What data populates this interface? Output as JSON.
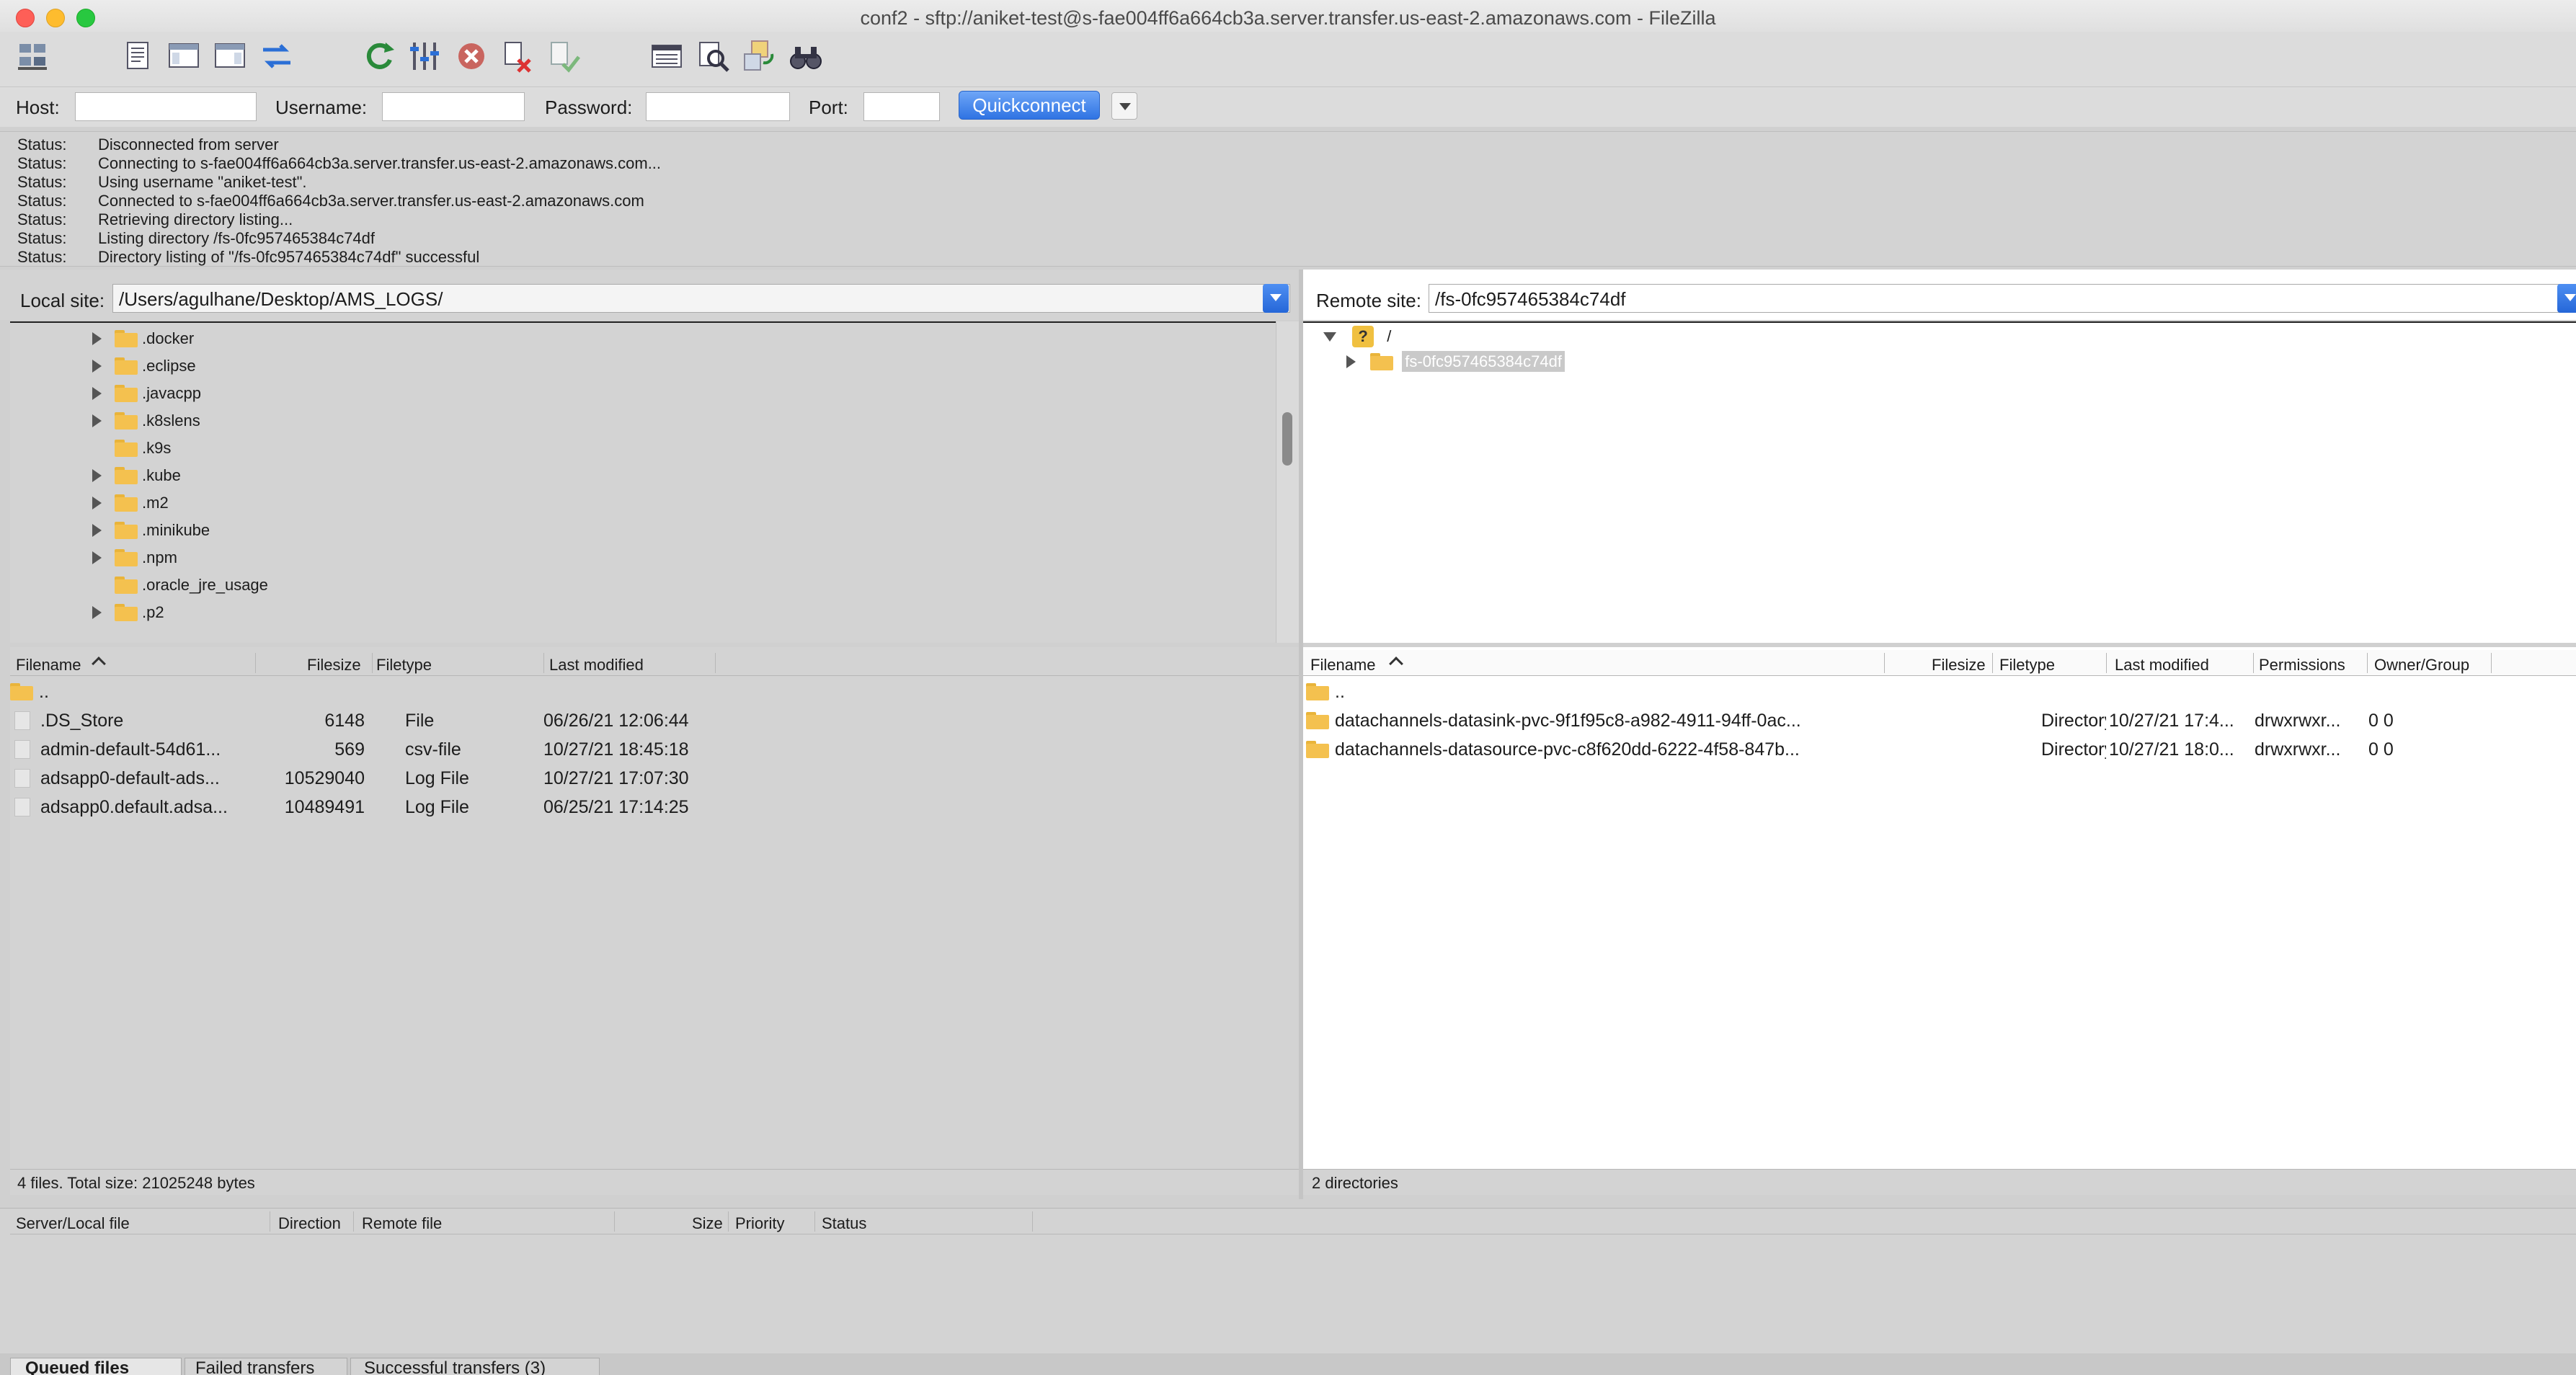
{
  "window": {
    "title": "conf2 - sftp://aniket-test@s-fae004ff6a664cb3a.server.transfer.us-east-2.amazonaws.com - FileZilla"
  },
  "toolbar": {
    "icons": [
      "site-manager-icon",
      "toggle-message-log-icon",
      "toggle-local-tree-icon",
      "toggle-remote-tree-icon",
      "toggle-transfer-queue-icon",
      "refresh-icon",
      "process-queue-icon",
      "cancel-icon",
      "disconnect-icon",
      "reconnect-icon",
      "directory-listing-filters-icon",
      "toggle-comparison-icon",
      "sync-browsing-icon",
      "search-remote-icon"
    ]
  },
  "quickconnect": {
    "host_label": "Host:",
    "host_value": "",
    "username_label": "Username:",
    "username_value": "",
    "password_label": "Password:",
    "password_value": "",
    "port_label": "Port:",
    "port_value": "",
    "button_label": "Quickconnect"
  },
  "message_log": [
    {
      "label": "Status:",
      "text": "Disconnected from server"
    },
    {
      "label": "Status:",
      "text": "Connecting to s-fae004ff6a664cb3a.server.transfer.us-east-2.amazonaws.com..."
    },
    {
      "label": "Status:",
      "text": "Using username \"aniket-test\"."
    },
    {
      "label": "Status:",
      "text": "Connected to s-fae004ff6a664cb3a.server.transfer.us-east-2.amazonaws.com"
    },
    {
      "label": "Status:",
      "text": "Retrieving directory listing..."
    },
    {
      "label": "Status:",
      "text": "Listing directory /fs-0fc957465384c74df"
    },
    {
      "label": "Status:",
      "text": "Directory listing of \"/fs-0fc957465384c74df\" successful"
    }
  ],
  "local": {
    "site_label": "Local site:",
    "site_path": "/Users/agulhane/Desktop/AMS_LOGS/",
    "tree": [
      {
        "name": ".docker",
        "expandable": true
      },
      {
        "name": ".eclipse",
        "expandable": true
      },
      {
        "name": ".javacpp",
        "expandable": true
      },
      {
        "name": ".k8slens",
        "expandable": true
      },
      {
        "name": ".k9s",
        "expandable": false
      },
      {
        "name": ".kube",
        "expandable": true
      },
      {
        "name": ".m2",
        "expandable": true
      },
      {
        "name": ".minikube",
        "expandable": true
      },
      {
        "name": ".npm",
        "expandable": true
      },
      {
        "name": ".oracle_jre_usage",
        "expandable": false
      },
      {
        "name": ".p2",
        "expandable": true
      }
    ],
    "columns": [
      "Filename",
      "Filesize",
      "Filetype",
      "Last modified"
    ],
    "parent_dir": "..",
    "files": [
      {
        "name": ".DS_Store",
        "size": "6148",
        "type": "File",
        "modified": "06/26/21 12:06:44"
      },
      {
        "name": "admin-default-54d61...",
        "size": "569",
        "type": "csv-file",
        "modified": "10/27/21 18:45:18"
      },
      {
        "name": "adsapp0-default-ads...",
        "size": "10529040",
        "type": "Log File",
        "modified": "10/27/21 17:07:30"
      },
      {
        "name": "adsapp0.default.adsa...",
        "size": "10489491",
        "type": "Log File",
        "modified": "06/25/21 17:14:25"
      }
    ],
    "status": "4 files. Total size: 21025248 bytes"
  },
  "remote": {
    "site_label": "Remote site:",
    "site_path": "/fs-0fc957465384c74df",
    "tree_root": "/",
    "tree_child": "fs-0fc957465384c74df",
    "columns": [
      "Filename",
      "Filesize",
      "Filetype",
      "Last modified",
      "Permissions",
      "Owner/Group"
    ],
    "parent_dir": "..",
    "files": [
      {
        "name": "datachannels-datasink-pvc-9f1f95c8-a982-4911-94ff-0ac...",
        "size": "",
        "type": "Directory",
        "modified": "10/27/21 17:4...",
        "perms": "drwxrwxr...",
        "owner": "0 0"
      },
      {
        "name": "datachannels-datasource-pvc-c8f620dd-6222-4f58-847b...",
        "size": "",
        "type": "Directory",
        "modified": "10/27/21 18:0...",
        "perms": "drwxrwxr...",
        "owner": "0 0"
      }
    ],
    "status": "2 directories"
  },
  "queue": {
    "columns": [
      "Server/Local file",
      "Direction",
      "Remote file",
      "Size",
      "Priority",
      "Status"
    ],
    "tabs": [
      "Queued files",
      "Failed transfers",
      "Successful transfers (3)"
    ]
  },
  "colors": {
    "accent": "#2f73e3",
    "folder": "#f4c14f"
  }
}
